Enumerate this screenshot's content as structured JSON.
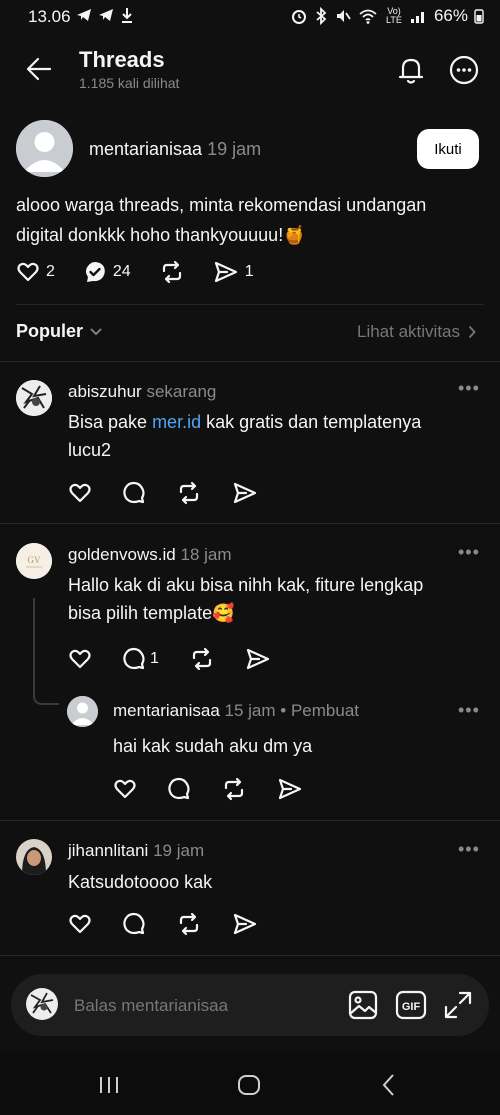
{
  "status_bar": {
    "time": "13.06",
    "battery": "66%",
    "network": "Vo) LTE"
  },
  "header": {
    "title": "Threads",
    "subtitle": "1.185 kali dilihat"
  },
  "post": {
    "username": "mentarianisaa",
    "time": "19 jam",
    "follow_label": "Ikuti",
    "text_line1": "alooo warga threads, minta rekomendasi undangan",
    "text_line2": "digital donkkk hoho thankyouuuu!🍯",
    "likes": "2",
    "reposts": "24",
    "shares": "1"
  },
  "sort": {
    "label": "Populer",
    "activity_link": "Lihat aktivitas"
  },
  "comments": [
    {
      "username": "abiszuhur",
      "time": "sekarang",
      "text_before": "Bisa pake ",
      "link": "mer.id",
      "text_after": " kak gratis dan templatenya",
      "text_line2": "lucu2"
    },
    {
      "username": "goldenvows.id",
      "time": "18 jam",
      "text_line1": "Hallo kak di aku bisa nihh kak, fiture lengkap",
      "text_line2": "bisa pilih template🥰",
      "comment_count": "1",
      "avatar_text": "GV"
    },
    {
      "username": "mentarianisaa",
      "time": "15 jam",
      "badge": "• Pembuat",
      "text_line1": "hai kak sudah aku dm ya"
    },
    {
      "username": "jihannlitani",
      "time": "19 jam",
      "text_line1": "Katsudotoooo kak"
    }
  ],
  "reply_bar": {
    "placeholder": "Balas mentarianisaa",
    "gif_label": "GIF"
  },
  "colors": {
    "background": "#101010",
    "text": "#f3f5f7",
    "muted": "#8a8a8a",
    "link": "#4ea4f6",
    "repost_badge": "#f3f5f7"
  }
}
